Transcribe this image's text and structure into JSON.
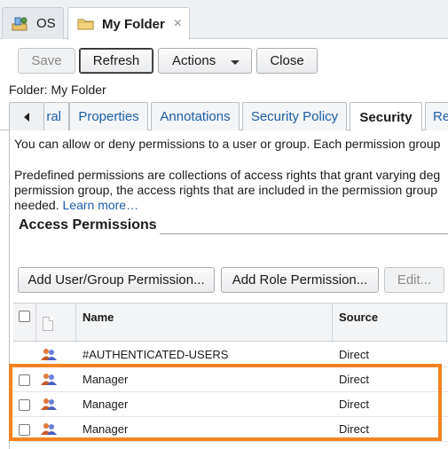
{
  "top_tabs": [
    {
      "label": "OS",
      "icon": "os-icon"
    },
    {
      "label": "My Folder",
      "icon": "folder-icon",
      "close": "×"
    }
  ],
  "toolbar": {
    "save": "Save",
    "refresh": "Refresh",
    "actions": "Actions",
    "close": "Close"
  },
  "folder_line": "Folder: My Folder",
  "tabs": {
    "general_partial": "ral",
    "properties": "Properties",
    "annotations": "Annotations",
    "security_policy": "Security Policy",
    "security": "Security",
    "re_partial": "Re"
  },
  "description": {
    "line1": "You can allow or deny permissions to a user or group. Each permission group",
    "line2": "Predefined permissions are collections of access rights that grant varying deg",
    "line3": "permission group, the access rights that are included in the permission group",
    "line4": "needed.",
    "learn_more": "Learn more…"
  },
  "access_permissions": {
    "heading": "Access Permissions",
    "add_user_group": "Add User/Group Permission...",
    "add_role": "Add Role Permission...",
    "edit": "Edit..."
  },
  "table": {
    "headers": {
      "name": "Name",
      "source": "Source"
    },
    "rows": [
      {
        "name": "#AUTHENTICATED-USERS",
        "source": "Direct",
        "checkbox": false
      },
      {
        "name": "Manager",
        "source": "Direct",
        "checkbox": true
      },
      {
        "name": "Manager",
        "source": "Direct",
        "checkbox": true
      },
      {
        "name": "Manager",
        "source": "Direct",
        "checkbox": true
      }
    ]
  },
  "colors": {
    "highlight": "#f58220",
    "link": "#1d5ea8"
  }
}
